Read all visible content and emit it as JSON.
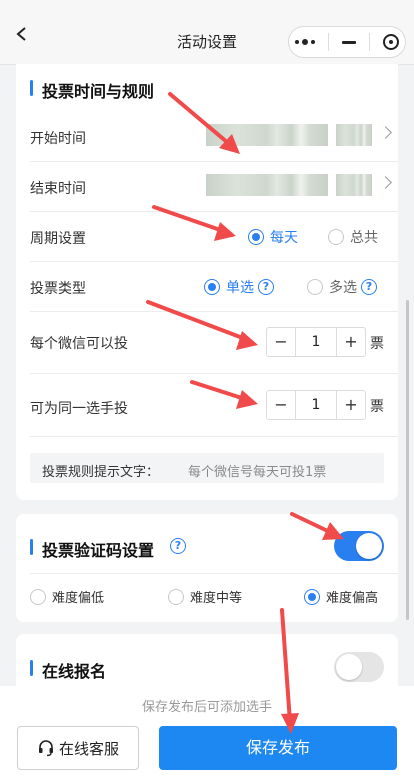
{
  "nav": {
    "title": "活动设置"
  },
  "vote_section": {
    "title": "投票时间与规则",
    "start_label": "开始时间",
    "end_label": "结束时间",
    "period": {
      "label": "周期设置",
      "options": [
        "每天",
        "总共"
      ],
      "selected": "每天"
    },
    "vote_type": {
      "label": "投票类型",
      "options": [
        "单选",
        "多选"
      ],
      "selected": "单选"
    },
    "per_wechat": {
      "label": "每个微信可以投",
      "value": "1",
      "unit": "票"
    },
    "per_candidate": {
      "label": "可为同一选手投",
      "value": "1",
      "unit": "票"
    },
    "tip": {
      "label": "投票规则提示文字：",
      "placeholder": "每个微信号每天可投1票"
    }
  },
  "captcha_section": {
    "title": "投票验证码设置",
    "enabled": true,
    "levels": [
      "难度偏低",
      "难度中等",
      "难度偏高"
    ],
    "selected": "难度偏高"
  },
  "signup_section": {
    "title": "在线报名",
    "enabled": false
  },
  "footer": {
    "hint": "保存发布后可添加选手",
    "service_label": "在线客服",
    "save_label": "保存发布"
  },
  "colors": {
    "accent": "#2a7ff0",
    "primary_button": "#1e88f2",
    "annotation_arrow": "#f04a4a"
  },
  "icons": [
    "back-icon",
    "more-dots-icon",
    "minimize-icon",
    "close-target-icon",
    "chevron-right-icon",
    "help-icon",
    "headset-icon"
  ]
}
